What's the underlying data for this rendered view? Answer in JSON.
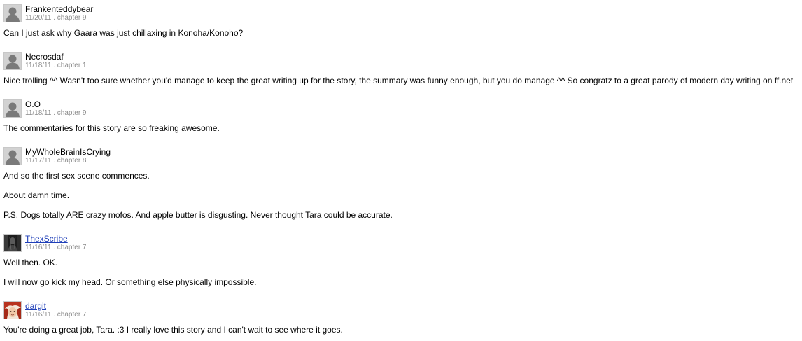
{
  "reviews": [
    {
      "reviewer": "Frankenteddybear",
      "reviewer_is_link": false,
      "avatar": "default-avatar",
      "date": "11/20/11",
      "separator": ".",
      "chapter": "chapter 9",
      "paragraphs": [
        "Can I just ask why Gaara was just chillaxing in Konoha/Konoho?"
      ]
    },
    {
      "reviewer": "Necrosdaf",
      "reviewer_is_link": false,
      "avatar": "default-avatar",
      "date": "11/18/11",
      "separator": ".",
      "chapter": "chapter 1",
      "paragraphs": [
        "Nice trolling ^^ Wasn't too sure whether you'd manage to keep the great writing up for the story, the summary was funny enough, but you do manage ^^ So congratz to a great parody of modern day writing on ff.net"
      ]
    },
    {
      "reviewer": "O.O",
      "reviewer_is_link": false,
      "avatar": "default-avatar",
      "date": "11/18/11",
      "separator": ".",
      "chapter": "chapter 9",
      "paragraphs": [
        "The commentaries for this story are so freaking awesome."
      ]
    },
    {
      "reviewer": "MyWholeBrainIsCrying",
      "reviewer_is_link": false,
      "avatar": "default-avatar",
      "date": "11/17/11",
      "separator": ".",
      "chapter": "chapter 8",
      "paragraphs": [
        "And so the first sex scene commences.",
        "About damn time.",
        "P.S. Dogs totally ARE crazy mofos. And apple butter is disgusting. Never thought Tara could be accurate."
      ]
    },
    {
      "reviewer": "ThexScribe",
      "reviewer_is_link": true,
      "avatar": "dark-figure-avatar",
      "date": "11/16/11",
      "separator": ".",
      "chapter": "chapter 7",
      "paragraphs": [
        "Well then. OK.",
        "I will now go kick my head. Or something else physically impossible."
      ]
    },
    {
      "reviewer": "dargit",
      "reviewer_is_link": true,
      "avatar": "red-hair-character-avatar",
      "date": "11/16/11",
      "separator": ".",
      "chapter": "chapter 7",
      "paragraphs": [
        "You're doing a great job, Tara. :3 I really love this story and I can't wait to see where it goes."
      ]
    }
  ],
  "colors": {
    "link": "#1f3fb8",
    "meta": "#8c8c8c",
    "text": "#000000",
    "background": "#ffffff"
  }
}
